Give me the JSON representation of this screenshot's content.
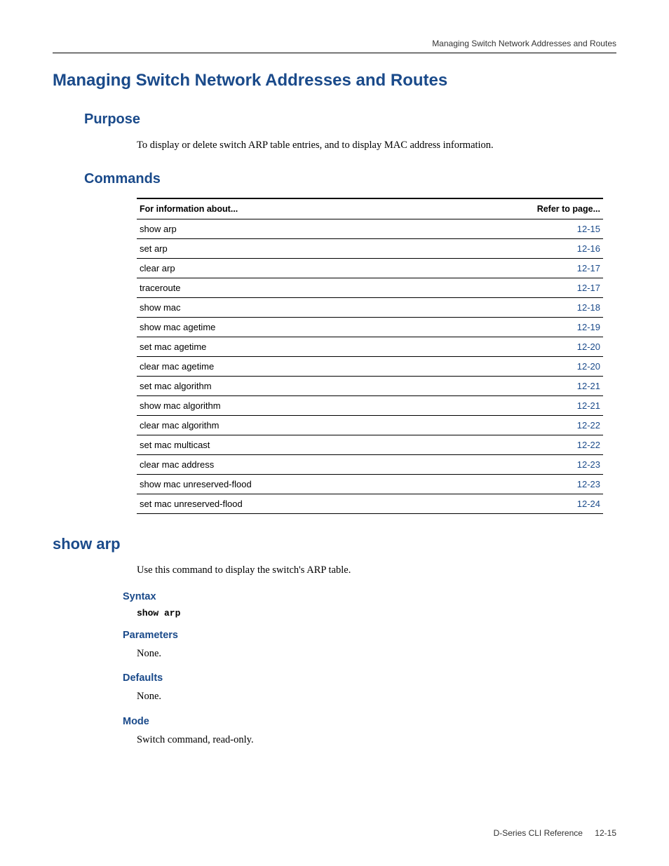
{
  "header": {
    "running_title": "Managing Switch Network Addresses and Routes"
  },
  "title": "Managing Switch Network Addresses and Routes",
  "purpose": {
    "heading": "Purpose",
    "text": "To display or delete switch ARP table entries, and to display MAC address information."
  },
  "commands": {
    "heading": "Commands",
    "table": {
      "col1": "For information about...",
      "col2": "Refer to page...",
      "rows": [
        {
          "name": "show arp",
          "page": "12-15"
        },
        {
          "name": "set arp",
          "page": "12-16"
        },
        {
          "name": "clear arp",
          "page": "12-17"
        },
        {
          "name": "traceroute",
          "page": "12-17"
        },
        {
          "name": "show mac",
          "page": "12-18"
        },
        {
          "name": "show mac agetime",
          "page": "12-19"
        },
        {
          "name": "set mac agetime",
          "page": "12-20"
        },
        {
          "name": "clear mac agetime",
          "page": "12-20"
        },
        {
          "name": "set mac algorithm",
          "page": "12-21"
        },
        {
          "name": "show mac algorithm",
          "page": "12-21"
        },
        {
          "name": "clear mac algorithm",
          "page": "12-22"
        },
        {
          "name": "set mac multicast",
          "page": "12-22"
        },
        {
          "name": "clear mac address",
          "page": "12-23"
        },
        {
          "name": "show mac unreserved-flood",
          "page": "12-23"
        },
        {
          "name": "set mac unreserved-flood",
          "page": "12-24"
        }
      ]
    }
  },
  "showarp": {
    "heading": "show arp",
    "description": "Use this command to display the switch's ARP table.",
    "syntax": {
      "heading": "Syntax",
      "code": "show arp"
    },
    "parameters": {
      "heading": "Parameters",
      "text": "None."
    },
    "defaults": {
      "heading": "Defaults",
      "text": "None."
    },
    "mode": {
      "heading": "Mode",
      "text": "Switch command, read-only."
    }
  },
  "footer": {
    "doc": "D-Series CLI Reference",
    "page": "12-15"
  }
}
